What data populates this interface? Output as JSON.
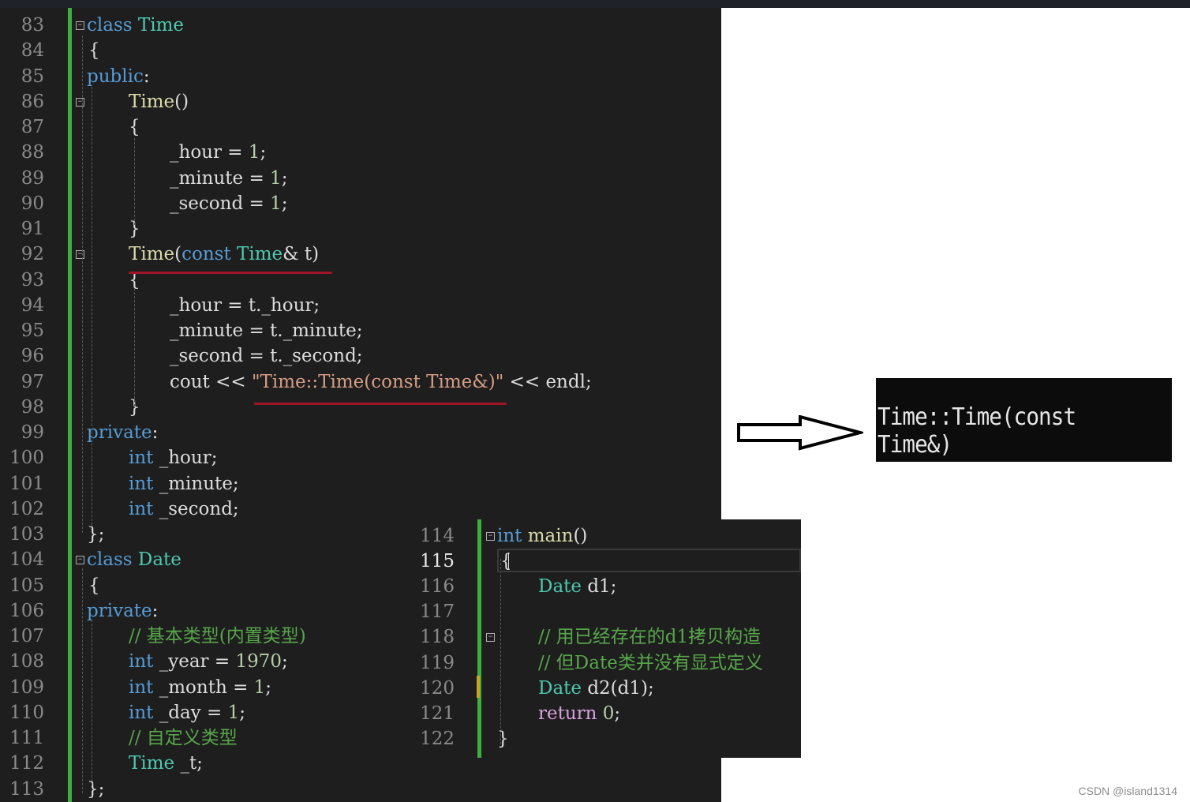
{
  "editor_left": {
    "lines": [
      {
        "n": "83",
        "t": [
          [
            "kw",
            "class "
          ],
          [
            "ty",
            "Time"
          ]
        ]
      },
      {
        "n": "84",
        "t": [
          [
            "var",
            "{"
          ]
        ]
      },
      {
        "n": "85",
        "t": [
          [
            "kw",
            "public"
          ],
          [
            "var",
            ":"
          ]
        ]
      },
      {
        "n": "86",
        "t": [
          [
            "fn",
            "Time"
          ],
          [
            "var",
            "()"
          ]
        ]
      },
      {
        "n": "87",
        "t": [
          [
            "var",
            "{"
          ]
        ]
      },
      {
        "n": "88",
        "t": [
          [
            "var",
            "_hour = "
          ],
          [
            "num",
            "1"
          ],
          [
            "var",
            ";"
          ]
        ]
      },
      {
        "n": "89",
        "t": [
          [
            "var",
            "_minute = "
          ],
          [
            "num",
            "1"
          ],
          [
            "var",
            ";"
          ]
        ]
      },
      {
        "n": "90",
        "t": [
          [
            "var",
            "_second = "
          ],
          [
            "num",
            "1"
          ],
          [
            "var",
            ";"
          ]
        ]
      },
      {
        "n": "91",
        "t": [
          [
            "var",
            "}"
          ]
        ]
      },
      {
        "n": "92",
        "t": [
          [
            "fn",
            "Time"
          ],
          [
            "var",
            "("
          ],
          [
            "kw",
            "const "
          ],
          [
            "ty",
            "Time"
          ],
          [
            "var",
            "& t)"
          ]
        ]
      },
      {
        "n": "93",
        "t": [
          [
            "var",
            "{"
          ]
        ]
      },
      {
        "n": "94",
        "t": [
          [
            "var",
            "_hour = t._hour;"
          ]
        ]
      },
      {
        "n": "95",
        "t": [
          [
            "var",
            "_minute = t._minute;"
          ]
        ]
      },
      {
        "n": "96",
        "t": [
          [
            "var",
            "_second = t._second;"
          ]
        ]
      },
      {
        "n": "97",
        "t": [
          [
            "var",
            "cout << "
          ],
          [
            "str",
            "\"Time::Time(const Time&)\""
          ],
          [
            "var",
            " << endl;"
          ]
        ]
      },
      {
        "n": "98",
        "t": [
          [
            "var",
            "}"
          ]
        ]
      },
      {
        "n": "99",
        "t": [
          [
            "kw",
            "private"
          ],
          [
            "var",
            ":"
          ]
        ]
      },
      {
        "n": "100",
        "t": [
          [
            "kw",
            "int "
          ],
          [
            "var",
            "_hour;"
          ]
        ]
      },
      {
        "n": "101",
        "t": [
          [
            "kw",
            "int "
          ],
          [
            "var",
            "_minute;"
          ]
        ]
      },
      {
        "n": "102",
        "t": [
          [
            "kw",
            "int "
          ],
          [
            "var",
            "_second;"
          ]
        ]
      },
      {
        "n": "103",
        "t": [
          [
            "var",
            "};"
          ]
        ]
      },
      {
        "n": "104",
        "t": [
          [
            "kw",
            "class "
          ],
          [
            "ty",
            "Date"
          ]
        ]
      },
      {
        "n": "105",
        "t": [
          [
            "var",
            "{"
          ]
        ]
      },
      {
        "n": "106",
        "t": [
          [
            "kw",
            "private"
          ],
          [
            "var",
            ":"
          ]
        ]
      },
      {
        "n": "107",
        "t": [
          [
            "cm",
            "// 基本类型(内置类型)"
          ]
        ]
      },
      {
        "n": "108",
        "t": [
          [
            "kw",
            "int "
          ],
          [
            "var",
            "_year = "
          ],
          [
            "num",
            "1970"
          ],
          [
            "var",
            ";"
          ]
        ]
      },
      {
        "n": "109",
        "t": [
          [
            "kw",
            "int "
          ],
          [
            "var",
            "_month = "
          ],
          [
            "num",
            "1"
          ],
          [
            "var",
            ";"
          ]
        ]
      },
      {
        "n": "110",
        "t": [
          [
            "kw",
            "int "
          ],
          [
            "var",
            "_day = "
          ],
          [
            "num",
            "1"
          ],
          [
            "var",
            ";"
          ]
        ]
      },
      {
        "n": "111",
        "t": [
          [
            "cm",
            "// 自定义类型"
          ]
        ]
      },
      {
        "n": "112",
        "t": [
          [
            "ty",
            "Time "
          ],
          [
            "var",
            "_t;"
          ]
        ]
      },
      {
        "n": "113",
        "t": [
          [
            "var",
            "};"
          ]
        ]
      }
    ]
  },
  "editor_right": {
    "lines": [
      {
        "n": "114",
        "t": [
          [
            "kw",
            "int "
          ],
          [
            "fn",
            "main"
          ],
          [
            "var",
            "()"
          ]
        ]
      },
      {
        "n": "115",
        "t": [
          [
            "var",
            "{"
          ]
        ]
      },
      {
        "n": "116",
        "t": [
          [
            "ty",
            "Date "
          ],
          [
            "var",
            "d1;"
          ]
        ]
      },
      {
        "n": "117",
        "t": []
      },
      {
        "n": "118",
        "t": [
          [
            "cm",
            "// 用已经存在的d1拷贝构造"
          ]
        ]
      },
      {
        "n": "119",
        "t": [
          [
            "cm",
            "// 但Date类并没有显式定义"
          ]
        ]
      },
      {
        "n": "120",
        "t": [
          [
            "ty",
            "Date "
          ],
          [
            "var",
            "d2(d1);"
          ]
        ]
      },
      {
        "n": "121",
        "t": [
          [
            "rk",
            "return "
          ],
          [
            "num",
            "0"
          ],
          [
            "var",
            ";"
          ]
        ]
      },
      {
        "n": "122",
        "t": [
          [
            "var",
            "}"
          ]
        ]
      }
    ]
  },
  "console": {
    "output": "Time::Time(const Time&)"
  },
  "watermark": "CSDN @island1314",
  "colors": {
    "keyword": "#569cd6",
    "type": "#4ec9b0",
    "function": "#dcdcaa",
    "string": "#d69d85",
    "number": "#b5cea8",
    "comment": "#57a64a",
    "return_keyword": "#d8a0df",
    "change_bar": "#3fae3f",
    "underline": "#a01428"
  },
  "icons": [
    "collapse-icon",
    "arrow-right-icon"
  ]
}
